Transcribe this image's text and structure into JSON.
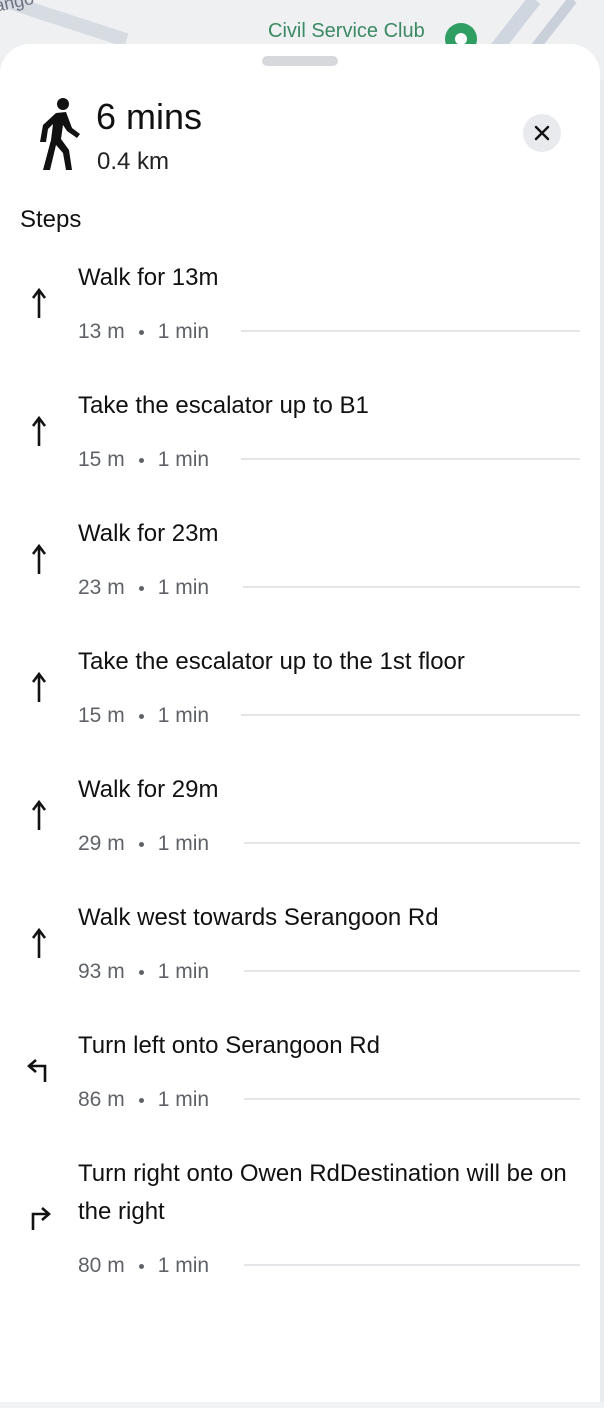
{
  "map": {
    "corner_text": "ango",
    "place_label": "Civil Service Club"
  },
  "summary": {
    "time": "6 mins",
    "distance": "0.4 km"
  },
  "steps_title": "Steps",
  "steps": [
    {
      "text": "Walk for 13m",
      "distance": "13 m",
      "duration": "1 min",
      "icon": "straight-arrow-icon"
    },
    {
      "text": "Take the escalator up to B1",
      "distance": "15 m",
      "duration": "1 min",
      "icon": "straight-arrow-icon"
    },
    {
      "text": "Walk for 23m",
      "distance": "23 m",
      "duration": "1 min",
      "icon": "straight-arrow-icon"
    },
    {
      "text": "Take the escalator up to the 1st floor",
      "distance": "15 m",
      "duration": "1 min",
      "icon": "straight-arrow-icon"
    },
    {
      "text": "Walk for 29m",
      "distance": "29 m",
      "duration": "1 min",
      "icon": "straight-arrow-icon"
    },
    {
      "text": "Walk west towards Serangoon Rd",
      "distance": "93 m",
      "duration": "1 min",
      "icon": "straight-arrow-icon"
    },
    {
      "text": "Turn left onto Serangoon Rd",
      "distance": "86 m",
      "duration": "1 min",
      "icon": "turn-left-icon"
    },
    {
      "text": "Turn right onto Owen RdDestination will be on the right",
      "distance": "80 m",
      "duration": "1 min",
      "icon": "turn-right-icon"
    }
  ]
}
